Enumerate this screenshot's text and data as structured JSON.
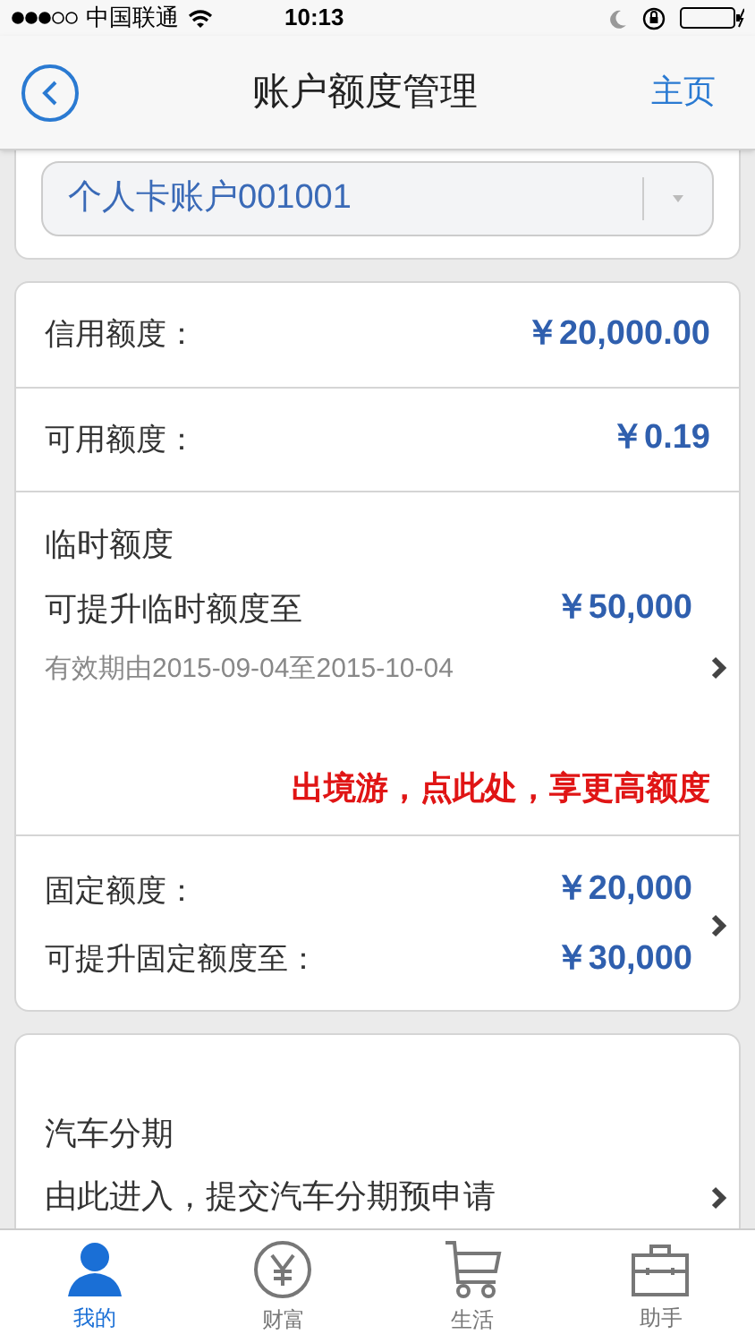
{
  "status_bar": {
    "carrier": "中国联通",
    "time": "10:13"
  },
  "nav": {
    "title": "账户额度管理",
    "home": "主页"
  },
  "account_select": {
    "value": "个人卡账户001001"
  },
  "limits": [
    {
      "kind": "row",
      "label": "信用额度：",
      "amount": "￥20,000.00"
    },
    {
      "kind": "row",
      "label": "可用额度：",
      "amount": "￥0.19"
    },
    {
      "kind": "temp",
      "title": "临时额度",
      "label": "可提升临时额度至",
      "amount": "￥50,000",
      "validity": "有效期由2015-09-04至2015-10-04",
      "promo": "出境游，点此处，享更高额度"
    },
    {
      "kind": "fixed",
      "label": "固定额度：",
      "amount": "￥20,000",
      "label2": "可提升固定额度至：",
      "amount2": "￥30,000"
    }
  ],
  "car_loan": {
    "title": "汽车分期",
    "text": "由此进入，提交汽车分期预申请"
  },
  "tabs": [
    {
      "label": "我的",
      "selected": true
    },
    {
      "label": "财富",
      "selected": false
    },
    {
      "label": "生活",
      "selected": false
    },
    {
      "label": "助手",
      "selected": false
    }
  ]
}
